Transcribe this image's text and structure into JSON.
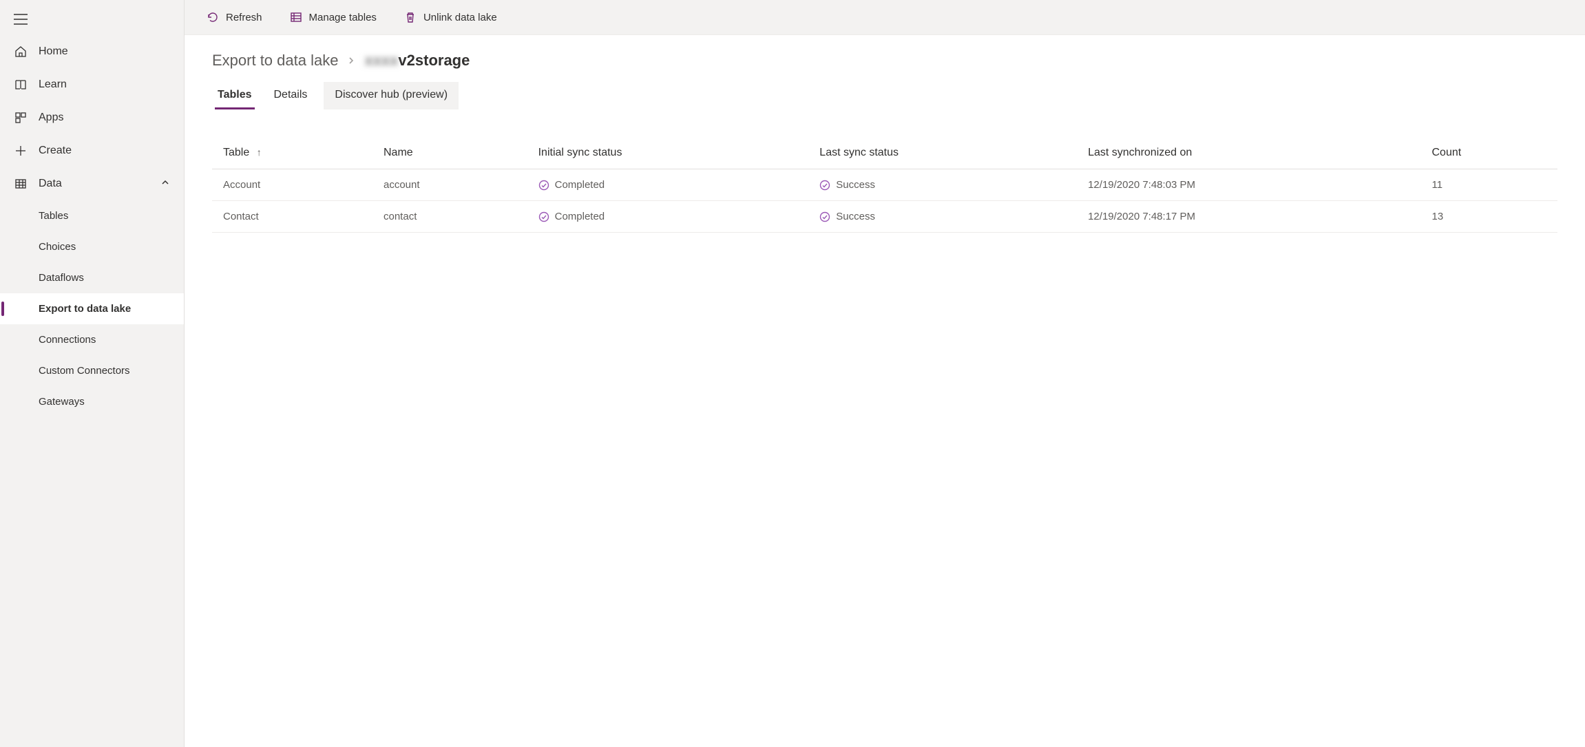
{
  "sidebar": {
    "items": [
      {
        "label": "Home"
      },
      {
        "label": "Learn"
      },
      {
        "label": "Apps"
      },
      {
        "label": "Create"
      },
      {
        "label": "Data",
        "expanded": true,
        "children": [
          {
            "label": "Tables"
          },
          {
            "label": "Choices"
          },
          {
            "label": "Dataflows"
          },
          {
            "label": "Export to data lake",
            "active": true
          },
          {
            "label": "Connections"
          },
          {
            "label": "Custom Connectors"
          },
          {
            "label": "Gateways"
          }
        ]
      }
    ]
  },
  "toolbar": {
    "refresh": "Refresh",
    "manage_tables": "Manage tables",
    "unlink": "Unlink data lake"
  },
  "breadcrumb": {
    "parent": "Export to data lake",
    "current_prefix_hidden": "xxxx",
    "current_suffix": "v2storage"
  },
  "tabs": [
    {
      "label": "Tables",
      "active": true
    },
    {
      "label": "Details"
    },
    {
      "label": "Discover hub (preview)",
      "preview": true
    }
  ],
  "table": {
    "columns": {
      "table": "Table",
      "name": "Name",
      "initial_sync": "Initial sync status",
      "last_sync": "Last sync status",
      "last_synced_on": "Last synchronized on",
      "count": "Count"
    },
    "sort_indicator": "↑",
    "rows": [
      {
        "table": "Account",
        "name": "account",
        "initial_sync": "Completed",
        "last_sync": "Success",
        "last_synced_on": "12/19/2020 7:48:03 PM",
        "count": "11"
      },
      {
        "table": "Contact",
        "name": "contact",
        "initial_sync": "Completed",
        "last_sync": "Success",
        "last_synced_on": "12/19/2020 7:48:17 PM",
        "count": "13"
      }
    ]
  }
}
